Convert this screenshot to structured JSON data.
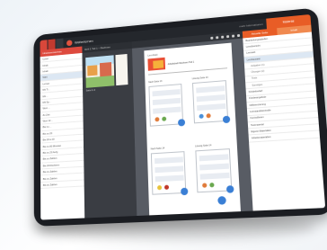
{
  "app": {
    "title": "Weiterlernen",
    "meta": "mehr Informationen",
    "orange_tab": "Material"
  },
  "sidebar": {
    "header": "Inhaltsverzeichnis",
    "items": [
      "Cover",
      "Inhalt",
      "Inhalt",
      "Start",
      "Lernen",
      "Mit Ti...",
      "Mit ...",
      "Mit Sp...",
      "Wort ...",
      "Zu Zeit",
      "Wort 12...",
      "Bis zu ...",
      "Bis zu 20",
      "Bis 20 a 20",
      "Bis zu 80 Minuten",
      "Bis zu 20 Aufg",
      "Bis zu Zahlen",
      "Bis 20 Rechnen",
      "Bis zu Zahlen",
      "Bis zu Zahlen",
      "Bis zu Zahlen"
    ]
  },
  "thumbs": {
    "header": "Heft 1 Teil 1 – Rechnen",
    "caption": "Seite 2–3"
  },
  "page": {
    "title": "Lernblatt",
    "caption": "Arbeitsheft Rechnen Teil 1",
    "worksheets": [
      {
        "label": "Nach Seite 13"
      },
      {
        "label": "Lösung Seite 13"
      },
      {
        "label": "Nach Seite 14"
      },
      {
        "label": "Lösung Seite 14"
      }
    ]
  },
  "right_panel": {
    "tab_left": "Aktuelle Seite",
    "tab_right": "Inhalt",
    "items": [
      {
        "label": "Bearbeitungstabellen",
        "sub": false,
        "selected": false
      },
      {
        "label": "Lernübersicht",
        "sub": false,
        "selected": false
      },
      {
        "label": "Lernwelt",
        "sub": false,
        "selected": false
      },
      {
        "label": "Lernbaustein",
        "sub": false,
        "selected": true
      },
      {
        "label": "Aufgaben (1)",
        "sub": true,
        "selected": false
      },
      {
        "label": "Übungen (2)",
        "sub": true,
        "selected": false
      },
      {
        "label": "Tests",
        "sub": true,
        "selected": false
      },
      {
        "label": "Sonstiges",
        "sub": true,
        "selected": false
      },
      {
        "label": "Förderbedarf",
        "sub": false,
        "selected": false
      },
      {
        "label": "Förderangebote",
        "sub": false,
        "selected": false
      },
      {
        "label": "Differenzierung",
        "sub": false,
        "selected": false
      },
      {
        "label": "Lernstandskontrolle",
        "sub": false,
        "selected": false
      },
      {
        "label": "Kontrollieren",
        "sub": false,
        "selected": false
      },
      {
        "label": "Testmaterial",
        "sub": false,
        "selected": false
      },
      {
        "label": "Eigene Materialien",
        "sub": false,
        "selected": false
      },
      {
        "label": "Arbeitsmaterialien",
        "sub": false,
        "selected": false
      }
    ]
  },
  "colors": {
    "accent": "#e85d26",
    "sidebar_header": "#dd4a3e",
    "fab": "#3a7fd5"
  }
}
